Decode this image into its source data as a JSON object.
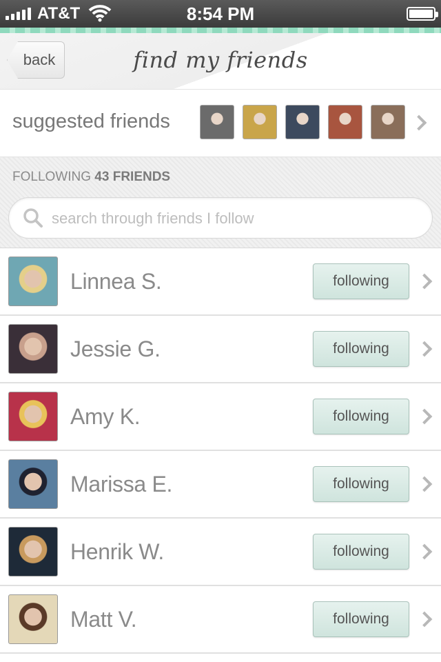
{
  "status_bar": {
    "carrier": "AT&T",
    "time": "8:54 PM"
  },
  "nav": {
    "back_label": "back",
    "title": "find my friends"
  },
  "suggested": {
    "label": "suggested friends",
    "thumbnail_colors": [
      "#6b6b6b",
      "#c9a54a",
      "#3d4a5e",
      "#a8553f",
      "#8a6e5a"
    ]
  },
  "following": {
    "prefix": "FOLLOWING",
    "count_label": "43 FRIENDS",
    "search_placeholder": "search through friends I follow"
  },
  "friends": [
    {
      "name": "Linnea S.",
      "button": "following",
      "avatar_colors": [
        "#6fa7b3",
        "#e4cf8a"
      ]
    },
    {
      "name": "Jessie G.",
      "button": "following",
      "avatar_colors": [
        "#3a2f38",
        "#c8a08c"
      ]
    },
    {
      "name": "Amy K.",
      "button": "following",
      "avatar_colors": [
        "#b8324a",
        "#e8c25a"
      ]
    },
    {
      "name": "Marissa E.",
      "button": "following",
      "avatar_colors": [
        "#5a7fa0",
        "#1f2230"
      ]
    },
    {
      "name": "Henrik W.",
      "button": "following",
      "avatar_colors": [
        "#1e2a38",
        "#c89a5e"
      ]
    },
    {
      "name": "Matt V.",
      "button": "following",
      "avatar_colors": [
        "#e4d8b8",
        "#5a3a28"
      ]
    }
  ]
}
